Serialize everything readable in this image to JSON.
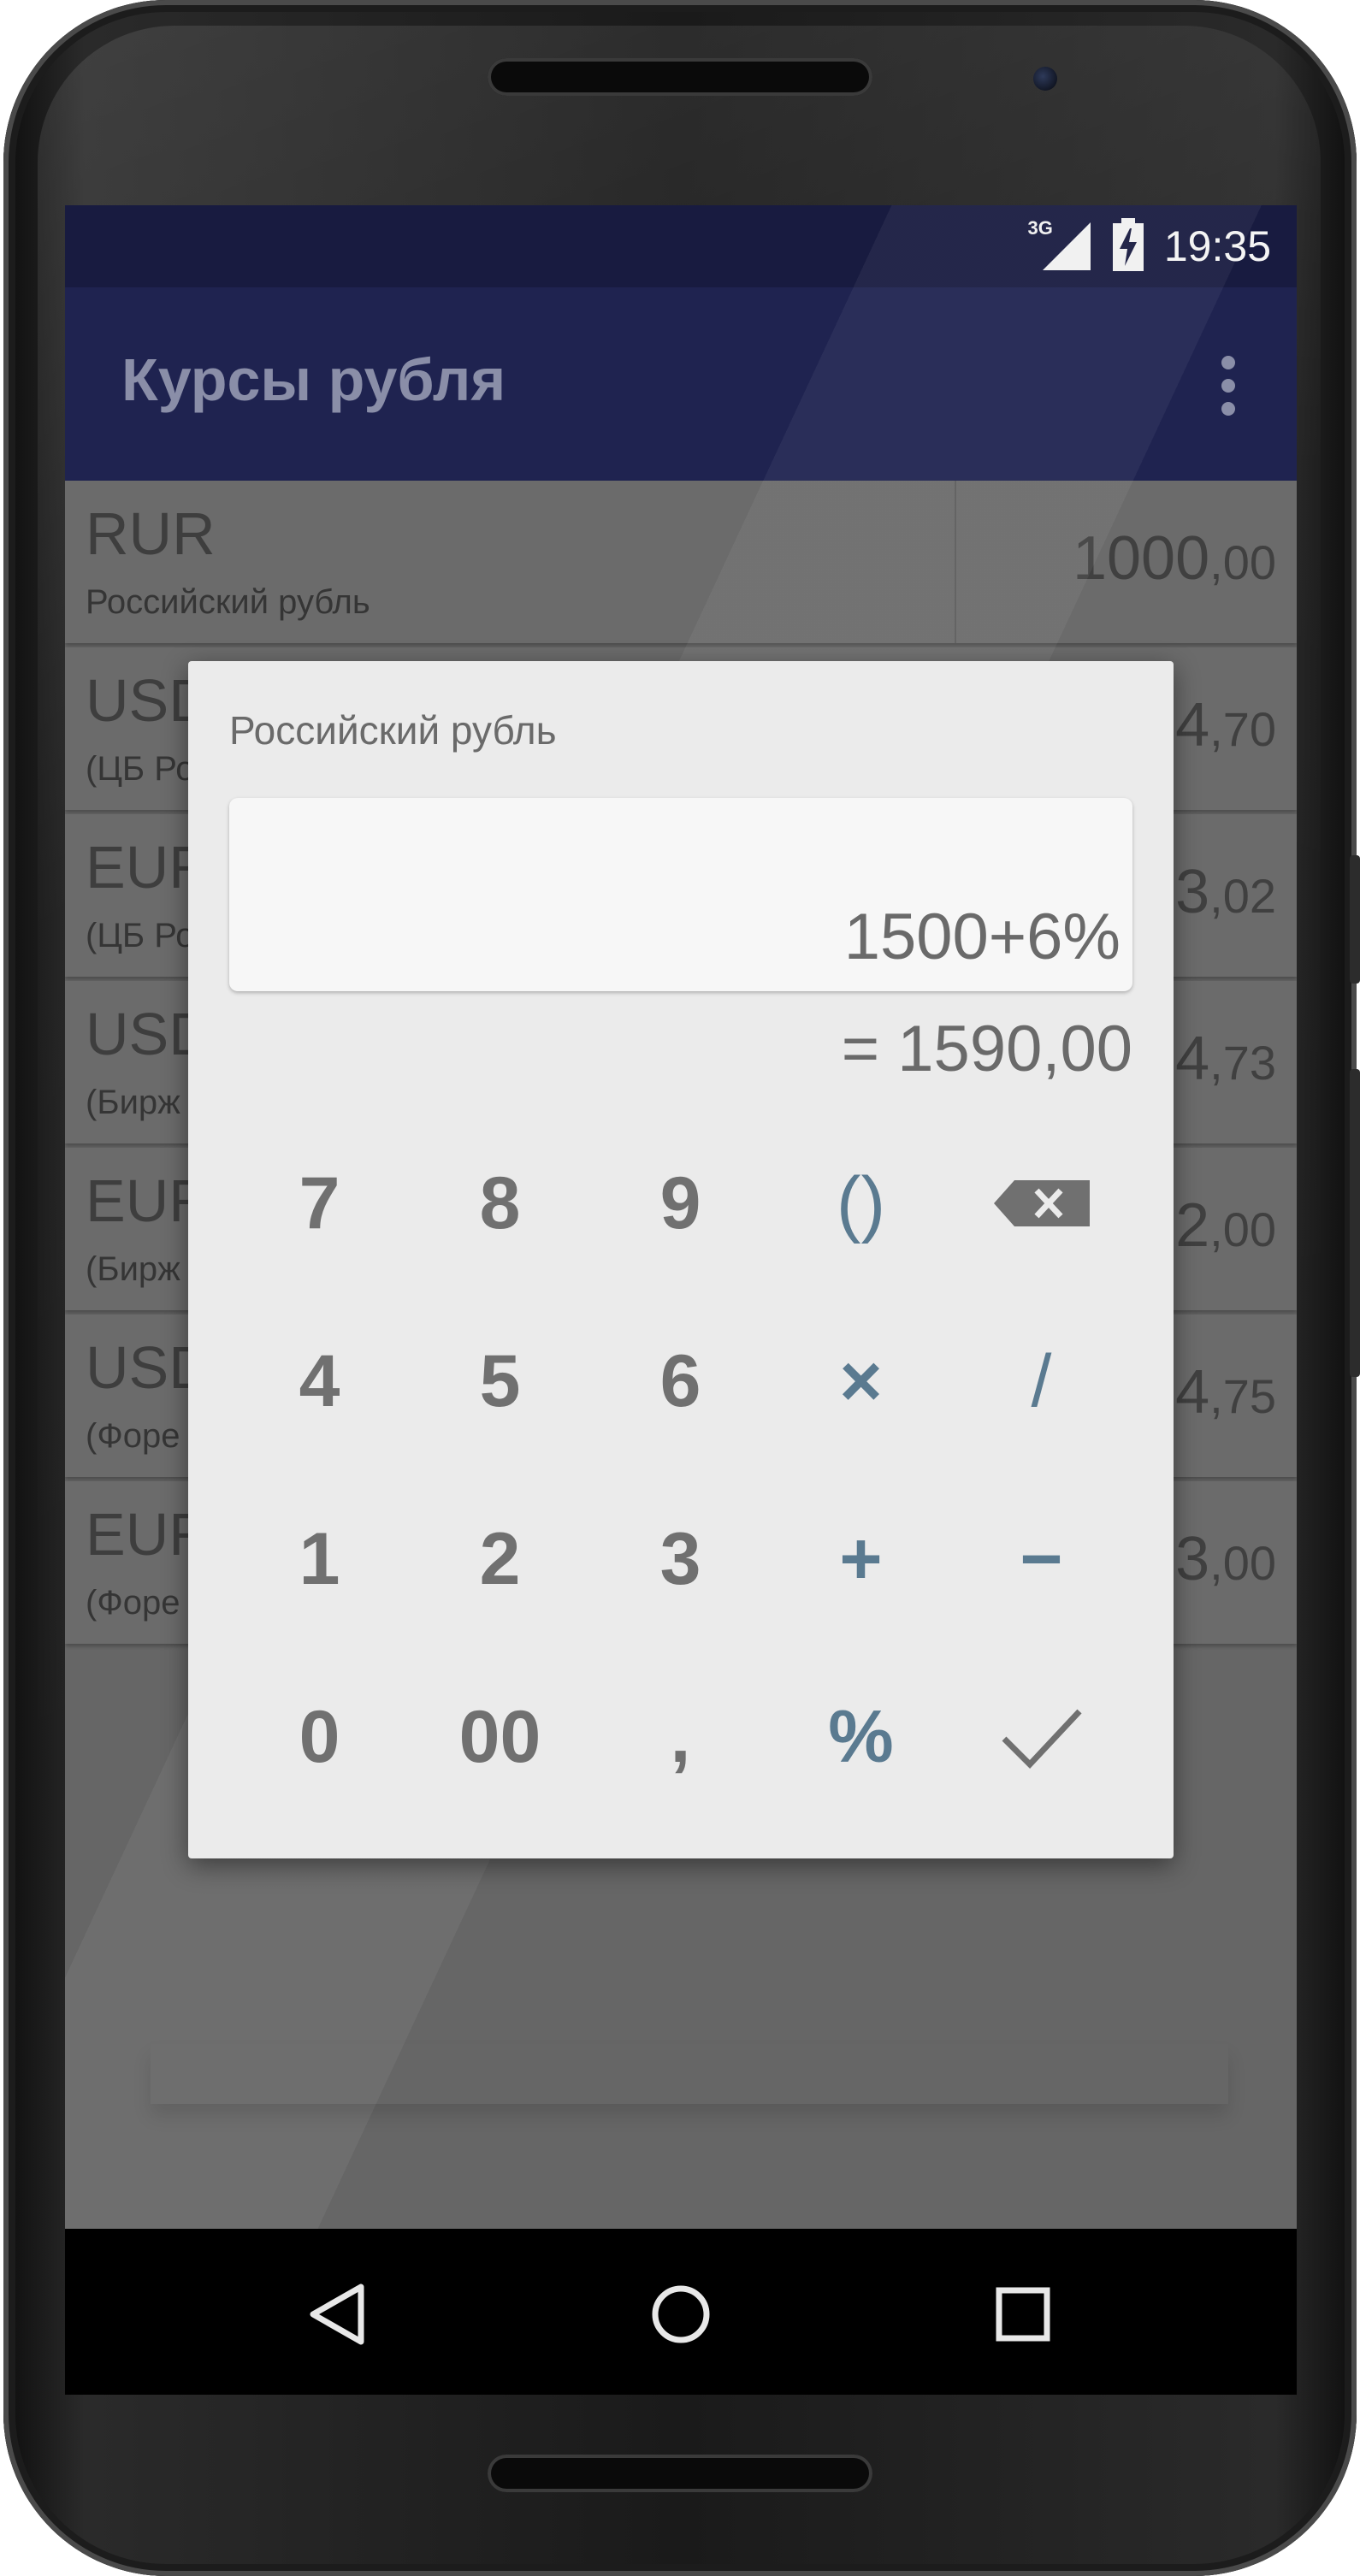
{
  "status_bar": {
    "network": "3G",
    "time": "19:35",
    "icons": [
      "signal-icon",
      "battery-charging-icon"
    ]
  },
  "app_bar": {
    "title": "Курсы рубля",
    "menu_icon": "more-vert-icon"
  },
  "rows": [
    {
      "code": "RUR",
      "name": "Российский рубль",
      "value_int": "1000",
      "value_dec": ",00"
    },
    {
      "code": "USD",
      "name": "(ЦБ Ро",
      "value_int": "4",
      "value_dec": ",70"
    },
    {
      "code": "EUR",
      "name": "(ЦБ Ро",
      "value_int": "3",
      "value_dec": ",02"
    },
    {
      "code": "USD",
      "name": "(Бирж",
      "value_int": "4",
      "value_dec": ",73"
    },
    {
      "code": "EUR",
      "name": "(Бирж",
      "value_int": "2",
      "value_dec": ",00"
    },
    {
      "code": "USD",
      "name": "(Форе",
      "value_int": "4",
      "value_dec": ",75"
    },
    {
      "code": "EUR",
      "name": "(Форе",
      "value_int": "3",
      "value_dec": ",00"
    }
  ],
  "dialog": {
    "title": "Российский рубль",
    "expression": "1500+6%",
    "result": "= 1590,00",
    "keys": [
      [
        {
          "label": "7"
        },
        {
          "label": "8"
        },
        {
          "label": "9"
        },
        {
          "label": "()",
          "op": true
        },
        {
          "label": "",
          "icon": "backspace-icon"
        }
      ],
      [
        {
          "label": "4"
        },
        {
          "label": "5"
        },
        {
          "label": "6"
        },
        {
          "label": "×",
          "op": true
        },
        {
          "label": "/",
          "op": true
        }
      ],
      [
        {
          "label": "1"
        },
        {
          "label": "2"
        },
        {
          "label": "3"
        },
        {
          "label": "+",
          "op": true
        },
        {
          "label": "−",
          "op": true
        }
      ],
      [
        {
          "label": "0"
        },
        {
          "label": "00"
        },
        {
          "label": ",",
          "op": false
        },
        {
          "label": "%",
          "op": true
        },
        {
          "label": "",
          "icon": "check-icon"
        }
      ]
    ]
  },
  "nav_bar": {
    "icons": [
      "back-icon",
      "home-icon",
      "recents-icon"
    ]
  },
  "colors": {
    "status_bar": "#181b40",
    "app_bar": "#1f2350",
    "dialog_bg": "#ebebeb",
    "operator_key": "#5a7a90",
    "digit_key": "#707070",
    "scrim": "#666666"
  }
}
